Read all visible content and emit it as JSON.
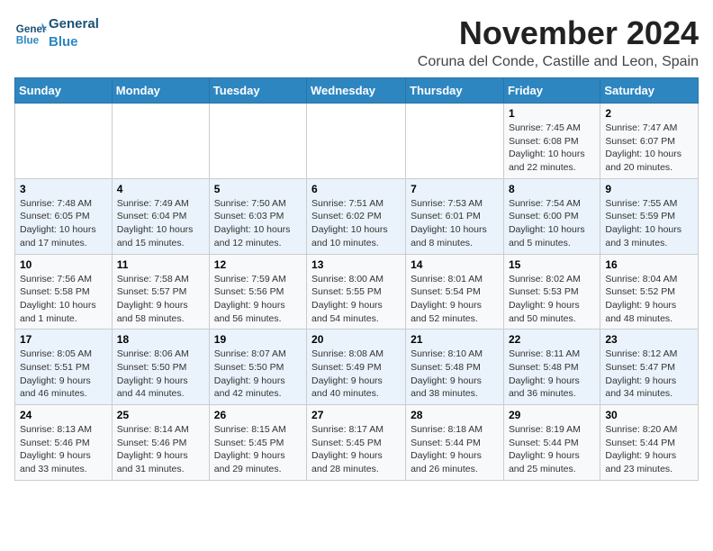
{
  "header": {
    "logo_general": "General",
    "logo_blue": "Blue",
    "month": "November 2024",
    "location": "Coruna del Conde, Castille and Leon, Spain"
  },
  "weekdays": [
    "Sunday",
    "Monday",
    "Tuesday",
    "Wednesday",
    "Thursday",
    "Friday",
    "Saturday"
  ],
  "weeks": [
    [
      {
        "day": "",
        "detail": ""
      },
      {
        "day": "",
        "detail": ""
      },
      {
        "day": "",
        "detail": ""
      },
      {
        "day": "",
        "detail": ""
      },
      {
        "day": "",
        "detail": ""
      },
      {
        "day": "1",
        "detail": "Sunrise: 7:45 AM\nSunset: 6:08 PM\nDaylight: 10 hours and 22 minutes."
      },
      {
        "day": "2",
        "detail": "Sunrise: 7:47 AM\nSunset: 6:07 PM\nDaylight: 10 hours and 20 minutes."
      }
    ],
    [
      {
        "day": "3",
        "detail": "Sunrise: 7:48 AM\nSunset: 6:05 PM\nDaylight: 10 hours and 17 minutes."
      },
      {
        "day": "4",
        "detail": "Sunrise: 7:49 AM\nSunset: 6:04 PM\nDaylight: 10 hours and 15 minutes."
      },
      {
        "day": "5",
        "detail": "Sunrise: 7:50 AM\nSunset: 6:03 PM\nDaylight: 10 hours and 12 minutes."
      },
      {
        "day": "6",
        "detail": "Sunrise: 7:51 AM\nSunset: 6:02 PM\nDaylight: 10 hours and 10 minutes."
      },
      {
        "day": "7",
        "detail": "Sunrise: 7:53 AM\nSunset: 6:01 PM\nDaylight: 10 hours and 8 minutes."
      },
      {
        "day": "8",
        "detail": "Sunrise: 7:54 AM\nSunset: 6:00 PM\nDaylight: 10 hours and 5 minutes."
      },
      {
        "day": "9",
        "detail": "Sunrise: 7:55 AM\nSunset: 5:59 PM\nDaylight: 10 hours and 3 minutes."
      }
    ],
    [
      {
        "day": "10",
        "detail": "Sunrise: 7:56 AM\nSunset: 5:58 PM\nDaylight: 10 hours and 1 minute."
      },
      {
        "day": "11",
        "detail": "Sunrise: 7:58 AM\nSunset: 5:57 PM\nDaylight: 9 hours and 58 minutes."
      },
      {
        "day": "12",
        "detail": "Sunrise: 7:59 AM\nSunset: 5:56 PM\nDaylight: 9 hours and 56 minutes."
      },
      {
        "day": "13",
        "detail": "Sunrise: 8:00 AM\nSunset: 5:55 PM\nDaylight: 9 hours and 54 minutes."
      },
      {
        "day": "14",
        "detail": "Sunrise: 8:01 AM\nSunset: 5:54 PM\nDaylight: 9 hours and 52 minutes."
      },
      {
        "day": "15",
        "detail": "Sunrise: 8:02 AM\nSunset: 5:53 PM\nDaylight: 9 hours and 50 minutes."
      },
      {
        "day": "16",
        "detail": "Sunrise: 8:04 AM\nSunset: 5:52 PM\nDaylight: 9 hours and 48 minutes."
      }
    ],
    [
      {
        "day": "17",
        "detail": "Sunrise: 8:05 AM\nSunset: 5:51 PM\nDaylight: 9 hours and 46 minutes."
      },
      {
        "day": "18",
        "detail": "Sunrise: 8:06 AM\nSunset: 5:50 PM\nDaylight: 9 hours and 44 minutes."
      },
      {
        "day": "19",
        "detail": "Sunrise: 8:07 AM\nSunset: 5:50 PM\nDaylight: 9 hours and 42 minutes."
      },
      {
        "day": "20",
        "detail": "Sunrise: 8:08 AM\nSunset: 5:49 PM\nDaylight: 9 hours and 40 minutes."
      },
      {
        "day": "21",
        "detail": "Sunrise: 8:10 AM\nSunset: 5:48 PM\nDaylight: 9 hours and 38 minutes."
      },
      {
        "day": "22",
        "detail": "Sunrise: 8:11 AM\nSunset: 5:48 PM\nDaylight: 9 hours and 36 minutes."
      },
      {
        "day": "23",
        "detail": "Sunrise: 8:12 AM\nSunset: 5:47 PM\nDaylight: 9 hours and 34 minutes."
      }
    ],
    [
      {
        "day": "24",
        "detail": "Sunrise: 8:13 AM\nSunset: 5:46 PM\nDaylight: 9 hours and 33 minutes."
      },
      {
        "day": "25",
        "detail": "Sunrise: 8:14 AM\nSunset: 5:46 PM\nDaylight: 9 hours and 31 minutes."
      },
      {
        "day": "26",
        "detail": "Sunrise: 8:15 AM\nSunset: 5:45 PM\nDaylight: 9 hours and 29 minutes."
      },
      {
        "day": "27",
        "detail": "Sunrise: 8:17 AM\nSunset: 5:45 PM\nDaylight: 9 hours and 28 minutes."
      },
      {
        "day": "28",
        "detail": "Sunrise: 8:18 AM\nSunset: 5:44 PM\nDaylight: 9 hours and 26 minutes."
      },
      {
        "day": "29",
        "detail": "Sunrise: 8:19 AM\nSunset: 5:44 PM\nDaylight: 9 hours and 25 minutes."
      },
      {
        "day": "30",
        "detail": "Sunrise: 8:20 AM\nSunset: 5:44 PM\nDaylight: 9 hours and 23 minutes."
      }
    ]
  ]
}
